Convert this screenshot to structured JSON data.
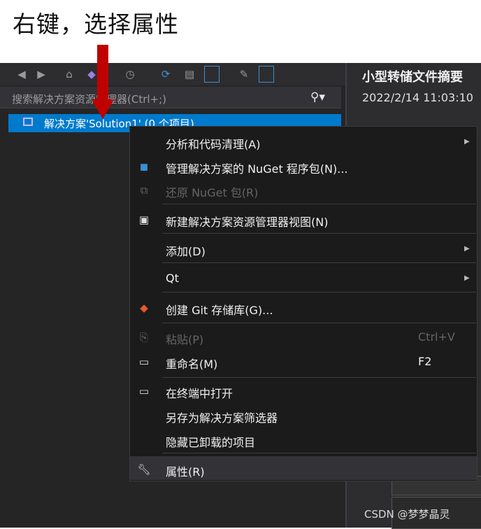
{
  "caption": "右键，选择属性",
  "search": {
    "placeholder": "搜索解决方案资源管理器(Ctrl+;)"
  },
  "tree": {
    "root_label": "解决方案'Solution1' (0 个项目)"
  },
  "right_pane": {
    "title": "小型转储文件摘要",
    "date": "2022/2/14 11:03:10"
  },
  "menu": {
    "analyze": "分析和代码清理(A)",
    "nuget_manage": "管理解决方案的 NuGet 程序包(N)...",
    "nuget_restore": "还原 NuGet 包(R)",
    "new_view": "新建解决方案资源管理器视图(N)",
    "add": "添加(D)",
    "qt": "Qt",
    "git": "创建 Git 存储库(G)...",
    "paste": "粘贴(P)",
    "paste_shortcut": "Ctrl+V",
    "rename": "重命名(M)",
    "rename_shortcut": "F2",
    "open_terminal": "在终端中打开",
    "save_filter": "另存为解决方案筛选器",
    "hide_unloaded": "隐藏已卸载的项目",
    "properties": "属性(R)"
  },
  "watermark": "CSDN @梦梦晶灵",
  "colors": {
    "arrow": "#c00000",
    "selection": "#007acc",
    "menu_bg": "#1b1b1c",
    "highlight": "#333337"
  }
}
